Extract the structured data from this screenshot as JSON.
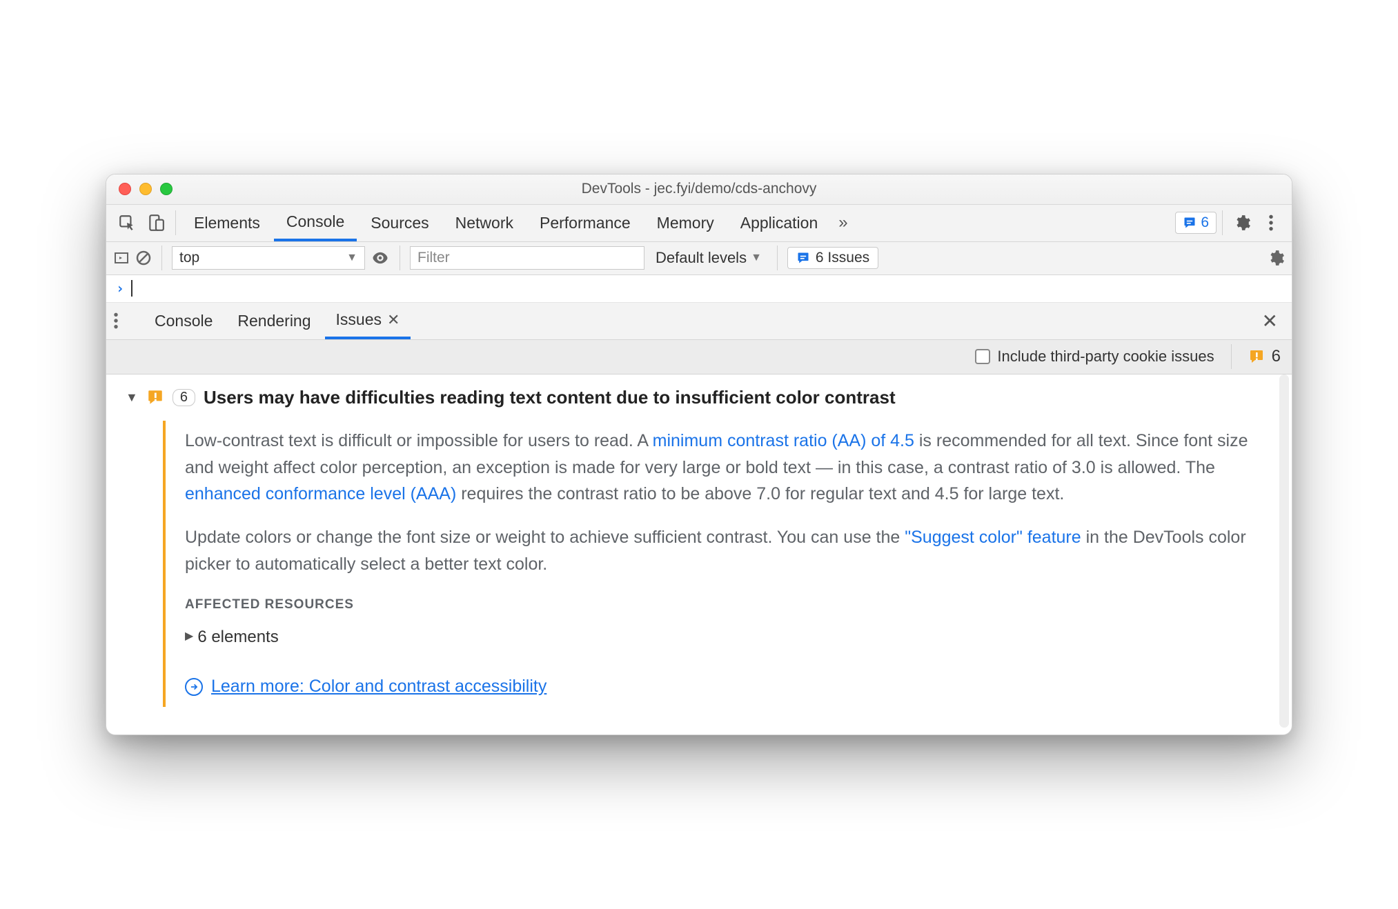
{
  "window": {
    "title": "DevTools - jec.fyi/demo/cds-anchovy"
  },
  "main_tabs": {
    "items": [
      "Elements",
      "Console",
      "Sources",
      "Network",
      "Performance",
      "Memory",
      "Application"
    ],
    "active_index": 1,
    "issues_badge": "6"
  },
  "console_toolbar": {
    "context": "top",
    "filter_placeholder": "Filter",
    "levels_label": "Default levels",
    "issues_label": "6 Issues"
  },
  "drawer": {
    "tabs": [
      "Console",
      "Rendering",
      "Issues"
    ],
    "active_index": 2
  },
  "options_bar": {
    "checkbox_label": "Include third-party cookie issues",
    "total_count": "6"
  },
  "issue": {
    "count": "6",
    "title": "Users may have difficulties reading text content due to insufficient color contrast",
    "para1_a": "Low-contrast text is difficult or impossible for users to read. A ",
    "link1": "minimum contrast ratio (AA) of 4.5",
    "para1_b": " is recommended for all text. Since font size and weight affect color perception, an exception is made for very large or bold text — in this case, a contrast ratio of 3.0 is allowed. The ",
    "link2": "enhanced conformance level (AAA)",
    "para1_c": " requires the contrast ratio to be above 7.0 for regular text and 4.5 for large text.",
    "para2_a": "Update colors or change the font size or weight to achieve sufficient contrast. You can use the ",
    "link3": "\"Suggest color\" feature",
    "para2_b": " in the DevTools color picker to automatically select a better text color.",
    "affected_label": "AFFECTED RESOURCES",
    "affected_text": "6 elements",
    "learn_more": "Learn more: Color and contrast accessibility"
  }
}
